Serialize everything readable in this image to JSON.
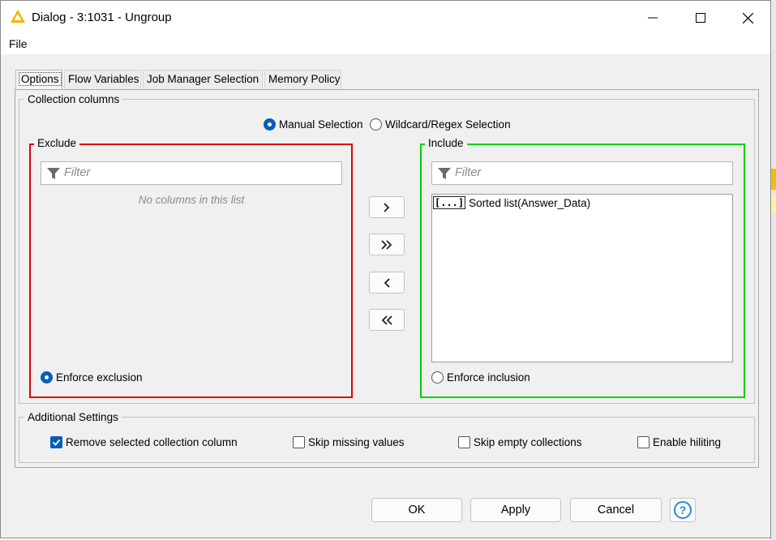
{
  "window": {
    "title": "Dialog - 3:1031 - Ungroup",
    "controls": {
      "minimize": "minimize",
      "maximize": "maximize",
      "close": "close"
    }
  },
  "menu": {
    "file_label": "File"
  },
  "tabs": [
    {
      "label": "Options",
      "active": true
    },
    {
      "label": "Flow Variables",
      "active": false
    },
    {
      "label": "Job Manager Selection",
      "active": false
    },
    {
      "label": "Memory Policy",
      "active": false
    }
  ],
  "collection_columns": {
    "title": "Collection columns",
    "mode_options": [
      {
        "label": "Manual Selection",
        "selected": true
      },
      {
        "label": "Wildcard/Regex Selection",
        "selected": false
      }
    ],
    "exclude": {
      "title": "Exclude",
      "border_color": "#e00000",
      "filter_placeholder": "Filter",
      "empty_message": "No columns in this list",
      "enforce_label": "Enforce exclusion",
      "enforce_selected": true
    },
    "include": {
      "title": "Include",
      "border_color": "#00d000",
      "filter_placeholder": "Filter",
      "items": [
        {
          "type_icon": "list-type-icon",
          "type_glyph": "[...]",
          "label": "Sorted list(Answer_Data)"
        }
      ],
      "enforce_label": "Enforce inclusion",
      "enforce_selected": false
    },
    "move_buttons": [
      {
        "name": "add",
        "glyph": "›"
      },
      {
        "name": "add-all",
        "glyph": "»"
      },
      {
        "name": "remove",
        "glyph": "‹"
      },
      {
        "name": "remove-all",
        "glyph": "«"
      }
    ]
  },
  "additional_settings": {
    "title": "Additional Settings",
    "options": [
      {
        "label": "Remove selected collection column",
        "checked": true
      },
      {
        "label": "Skip missing values",
        "checked": false
      },
      {
        "label": "Skip empty collections",
        "checked": false
      },
      {
        "label": "Enable hiliting",
        "checked": false
      }
    ]
  },
  "footer": {
    "ok_label": "OK",
    "apply_label": "Apply",
    "cancel_label": "Cancel",
    "help_glyph": "?"
  },
  "colors": {
    "accent": "#005fb8",
    "exclude_border": "#e00000",
    "include_border": "#00d000",
    "warning_icon": "#f5b400",
    "help_icon": "#2a8ad6"
  }
}
